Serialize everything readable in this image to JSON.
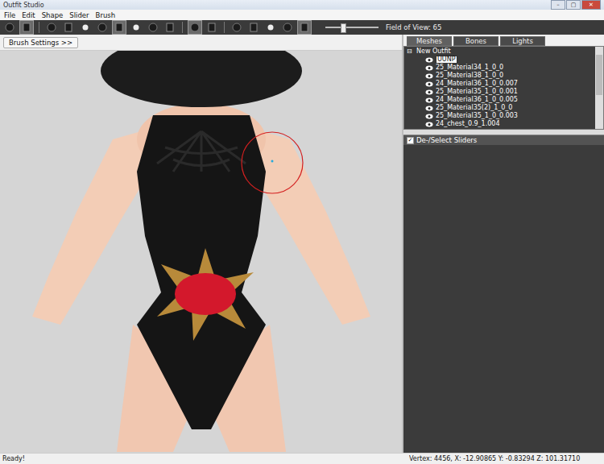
{
  "window": {
    "title": "Outfit Studio",
    "controls": [
      "–",
      "▢",
      "✕"
    ]
  },
  "menu": [
    "File",
    "Edit",
    "Shape",
    "Slider",
    "Brush"
  ],
  "toolbar": {
    "tools": [
      {
        "kind": "tool",
        "selected": false
      },
      {
        "kind": "tool",
        "selected": true
      },
      {
        "kind": "separator",
        "selected": false
      },
      {
        "kind": "tool",
        "selected": false
      },
      {
        "kind": "tool",
        "selected": false
      },
      {
        "kind": "tool",
        "selected": false
      },
      {
        "kind": "tool",
        "selected": false
      },
      {
        "kind": "tool",
        "selected": true
      },
      {
        "kind": "tool",
        "selected": false
      },
      {
        "kind": "tool",
        "selected": false
      },
      {
        "kind": "tool",
        "selected": false
      },
      {
        "kind": "separator",
        "selected": false
      },
      {
        "kind": "tool",
        "selected": true
      },
      {
        "kind": "tool",
        "selected": false
      },
      {
        "kind": "separator",
        "selected": false
      },
      {
        "kind": "tool",
        "selected": false
      },
      {
        "kind": "tool",
        "selected": false
      },
      {
        "kind": "tool",
        "selected": false
      },
      {
        "kind": "tool",
        "selected": false
      },
      {
        "kind": "tool",
        "selected": true
      }
    ],
    "fov": {
      "level": 0.33,
      "label": "Field of View: 65"
    }
  },
  "brush_settings": "Brush Settings >>",
  "tabs": [
    {
      "label": "Meshes",
      "selected": true
    },
    {
      "label": "Bones",
      "selected": false
    },
    {
      "label": "Lights",
      "selected": false
    }
  ],
  "tree": {
    "root": "New Outfit",
    "expanded": true,
    "toggle": "⊟",
    "items": [
      {
        "label": "UUNP",
        "selected": true
      },
      {
        "label": "25_Material34_1_0_0",
        "selected": false
      },
      {
        "label": "25_Material38_1_0_0",
        "selected": false
      },
      {
        "label": "24_Material36_1_0_0.007",
        "selected": false
      },
      {
        "label": "25_Material35_1_0_0.001",
        "selected": false
      },
      {
        "label": "24_Material36_1_0_0.005",
        "selected": false
      },
      {
        "label": "25_Material35(2)_1_0_0",
        "selected": false
      },
      {
        "label": "25_Material35_1_0_0.003",
        "selected": false
      },
      {
        "label": "24_chest_0.9_1.004",
        "selected": false
      }
    ]
  },
  "sliders_panel": {
    "label": "De-/Select Sliders",
    "checked": true
  },
  "status_bar": {
    "left": "Ready!",
    "right": "Vertex: 4456, X: -12.90865 Y: -0.83294 Z: 101.31710"
  }
}
